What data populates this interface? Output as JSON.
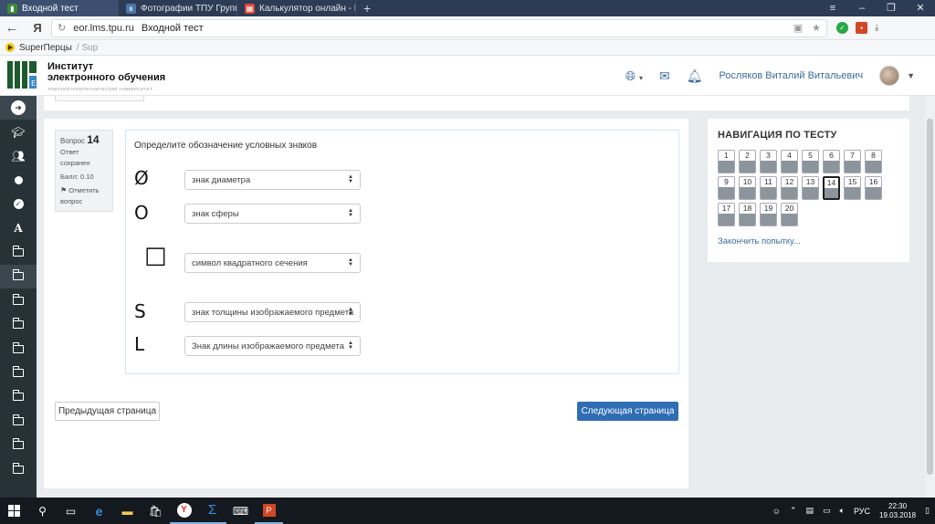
{
  "browser": {
    "tabs": [
      {
        "label": "Входной тест",
        "active": true
      },
      {
        "label": "Фотографии ТПУ Группа З",
        "active": false
      },
      {
        "label": "Калькулятор онлайн - Реш",
        "active": false
      }
    ],
    "url_domain": "eor.lms.tpu.ru",
    "url_title": "Входной тест",
    "bookmark": "SuperПерцы",
    "bookmark_more": "/ Sup"
  },
  "site": {
    "logo_line1": "Институт",
    "logo_line2": "электронного обучения",
    "logo_sub": "ТОМСКИЙ ПОЛИТЕХНИЧЕСКИЙ УНИВЕРСИТЕТ",
    "username": "Росляков Виталий Витальевич"
  },
  "question": {
    "label": "Вопрос",
    "number": "14",
    "status": "Ответ сохранен",
    "score": "Балл: 0.10",
    "flag": "Отметить вопрос",
    "prompt": "Определите обозначение условных знаков",
    "rows": [
      {
        "symbol": "Ø",
        "answer": "знак диаметра"
      },
      {
        "symbol": "O",
        "answer": "знак сферы"
      },
      {
        "symbol": "□",
        "answer": "символ квадратного сечения"
      },
      {
        "symbol": "S",
        "answer": "знак толщины изображаемого предмета"
      },
      {
        "symbol": "L",
        "answer": "Знак длины изображаемого предмета"
      }
    ]
  },
  "buttons": {
    "prev": "Предыдущая страница",
    "next": "Следующая страница"
  },
  "nav": {
    "title": "НАВИГАЦИЯ ПО ТЕСТУ",
    "numbers": [
      "1",
      "2",
      "3",
      "4",
      "5",
      "6",
      "7",
      "8",
      "9",
      "10",
      "11",
      "12",
      "13",
      "14",
      "15",
      "16",
      "17",
      "18",
      "19",
      "20"
    ],
    "current": "14",
    "finish": "Закончить попытку..."
  },
  "taskbar": {
    "lang": "РУС",
    "time": "22:30",
    "date": "19.03.2018"
  },
  "colors": {
    "accent": "#2f6db5",
    "sidebar": "#263238",
    "link": "#3d6b9e"
  }
}
